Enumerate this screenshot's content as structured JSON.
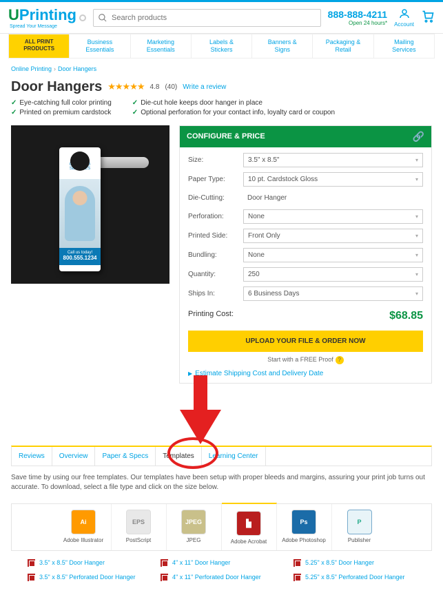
{
  "header": {
    "logo_u": "U",
    "logo_p": "Printing",
    "tagline": "Spread Your Message",
    "search_placeholder": "Search products",
    "phone": "888-888-4211",
    "phone_sub": "Open 24 hours*",
    "account": "Account"
  },
  "nav": [
    "ALL PRINT PRODUCTS",
    "Business\nEssentials",
    "Marketing\nEssentials",
    "Labels &\nStickers",
    "Banners &\nSigns",
    "Packaging &\nRetail",
    "Mailing\nServices"
  ],
  "breadcrumb": {
    "a": "Online Printing",
    "b": "Door Hangers"
  },
  "title": "Door Hangers",
  "rating": "4.8",
  "review_count": "(40)",
  "write_review": "Write a review",
  "features_left": [
    "Eye-catching full color printing",
    "Printed on premium cardstock"
  ],
  "features_right": [
    "Die-cut hole keeps door hanger in place",
    "Optional perforation for your contact info, loyalty card or coupon"
  ],
  "hanger": {
    "brand": "CLEANING\nSERVICES",
    "cta": "Call us today!",
    "phone": "800.555.1234"
  },
  "config": {
    "head": "CONFIGURE & PRICE",
    "rows": {
      "size": {
        "label": "Size:",
        "value": "3.5\" x 8.5\""
      },
      "paper": {
        "label": "Paper Type:",
        "value": "10 pt. Cardstock Gloss"
      },
      "die": {
        "label": "Die-Cutting:",
        "value": "Door Hanger"
      },
      "perf": {
        "label": "Perforation:",
        "value": "None"
      },
      "side": {
        "label": "Printed Side:",
        "value": "Front Only"
      },
      "bundle": {
        "label": "Bundling:",
        "value": "None"
      },
      "qty": {
        "label": "Quantity:",
        "value": "250"
      },
      "ships": {
        "label": "Ships In:",
        "value": "6 Business Days"
      }
    },
    "price_label": "Printing Cost:",
    "price": "$68.85",
    "upload": "UPLOAD YOUR FILE & ORDER NOW",
    "free_proof": "Start with a FREE Proof",
    "estimate": "Estimate Shipping Cost and Delivery Date"
  },
  "tabs": [
    "Reviews",
    "Overview",
    "Paper & Specs",
    "Templates",
    "Learning Center"
  ],
  "tab_desc": "Save time by using our free templates. Our templates have been setup with proper bleeds and margins, assuring your print job turns out accurate. To download, select a file type and click on the size below.",
  "formats": [
    {
      "short": "Ai",
      "label": "Adobe Illustrator",
      "cls": "ai"
    },
    {
      "short": "EPS",
      "label": "PostScript",
      "cls": "eps"
    },
    {
      "short": "JPEG",
      "label": "JPEG",
      "cls": "jpeg-i"
    },
    {
      "short": "",
      "label": "Adobe Acrobat",
      "cls": "pdf"
    },
    {
      "short": "Ps",
      "label": "Adobe Photoshop",
      "cls": "psd"
    },
    {
      "short": "P",
      "label": "Publisher",
      "cls": "pub"
    }
  ],
  "downloads": {
    "col1": [
      "3.5\" x 8.5\" Door Hanger",
      "3.5\" x 8.5\" Perforated Door Hanger"
    ],
    "col2": [
      "4\" x 11\" Door Hanger",
      "4\" x 11\" Perforated Door Hanger"
    ],
    "col3": [
      "5.25\" x 8.5\" Door Hanger",
      "5.25\" x 8.5\" Perforated Door Hanger"
    ]
  }
}
